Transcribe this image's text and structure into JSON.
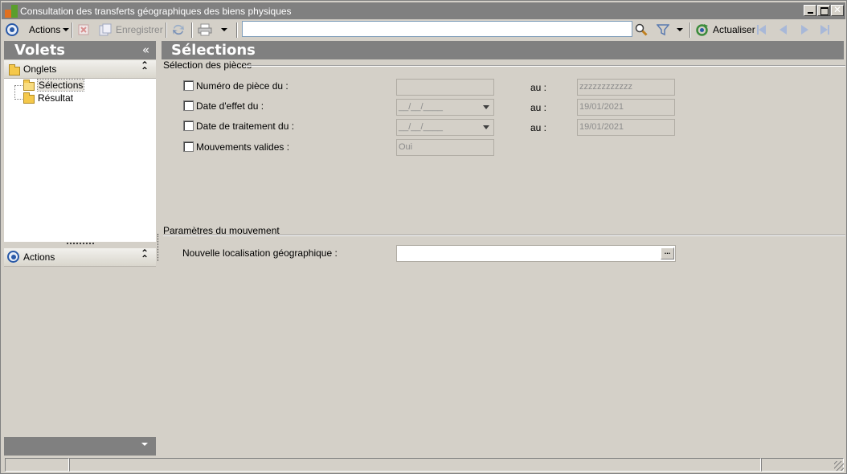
{
  "window": {
    "title": "Consultation des transferts géographiques des biens physiques"
  },
  "toolbar": {
    "actions_label": "Actions",
    "save_label": "Enregistrer",
    "search_value": "",
    "refresh_label": "Actualiser"
  },
  "left_pane": {
    "title": "Volets",
    "collapse_glyph": "«",
    "onglets_group": {
      "label": "Onglets",
      "items": [
        {
          "label": "Sélections",
          "selected": true
        },
        {
          "label": "Résultat",
          "selected": false
        }
      ]
    },
    "actions_group": {
      "label": "Actions"
    }
  },
  "main": {
    "title": "Sélections",
    "selection_section": {
      "title": "Sélection des pièces",
      "rows": [
        {
          "label": "Numéro de pièce du :",
          "checked": false,
          "from_value": "",
          "to_label": "au :",
          "to_value": "zzzzzzzzzzzz"
        },
        {
          "label": "Date d'effet du :",
          "checked": false,
          "from_value": "__/__/____",
          "to_label": "au :",
          "to_value": "19/01/2021"
        },
        {
          "label": "Date de traitement du :",
          "checked": false,
          "from_value": "__/__/____",
          "to_label": "au :",
          "to_value": "19/01/2021"
        },
        {
          "label": "Mouvements valides :",
          "checked": false,
          "from_value": "Oui"
        }
      ]
    },
    "movement_section": {
      "title": "Paramètres du mouvement",
      "location_label": "Nouvelle localisation géographique :",
      "location_value": "",
      "browse_label": "..."
    }
  },
  "colors": {
    "header_gray": "#808080",
    "window_bg": "#d4d0c8",
    "accent_blue": "#2a5aa8"
  },
  "icons": [
    "app-icon",
    "actions-icon",
    "delete-icon",
    "save-icon",
    "sync-icon",
    "print-icon",
    "search-icon",
    "filter-icon",
    "refresh-icon",
    "first-record-icon",
    "previous-record-icon",
    "next-record-icon",
    "last-record-icon",
    "folder-icon",
    "folder-open-icon"
  ]
}
